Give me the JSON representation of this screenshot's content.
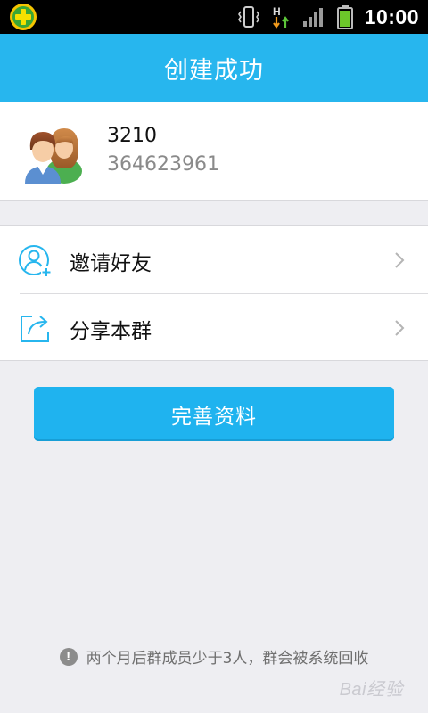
{
  "status_bar": {
    "time": "10:00",
    "network_type": "H",
    "icons": [
      "app-plus-icon",
      "vibrate-icon",
      "data-transfer-icon",
      "signal-icon",
      "battery-icon"
    ]
  },
  "header": {
    "title": "创建成功"
  },
  "group": {
    "name": "3210",
    "number": "364623961",
    "avatar_icon": "group-avatar-icon"
  },
  "actions": [
    {
      "label": "邀请好友",
      "icon": "invite-person-icon"
    },
    {
      "label": "分享本群",
      "icon": "share-icon"
    }
  ],
  "primary_button": {
    "label": "完善资料"
  },
  "notice": {
    "icon": "!",
    "text": "两个月后群成员少于3人，群会被系统回收"
  },
  "watermark": {
    "text": "Bai经验"
  },
  "colors": {
    "accent": "#27b6ee",
    "button": "#1fb3ef",
    "background": "#eeeef2",
    "muted_text": "#8a8a8a"
  }
}
